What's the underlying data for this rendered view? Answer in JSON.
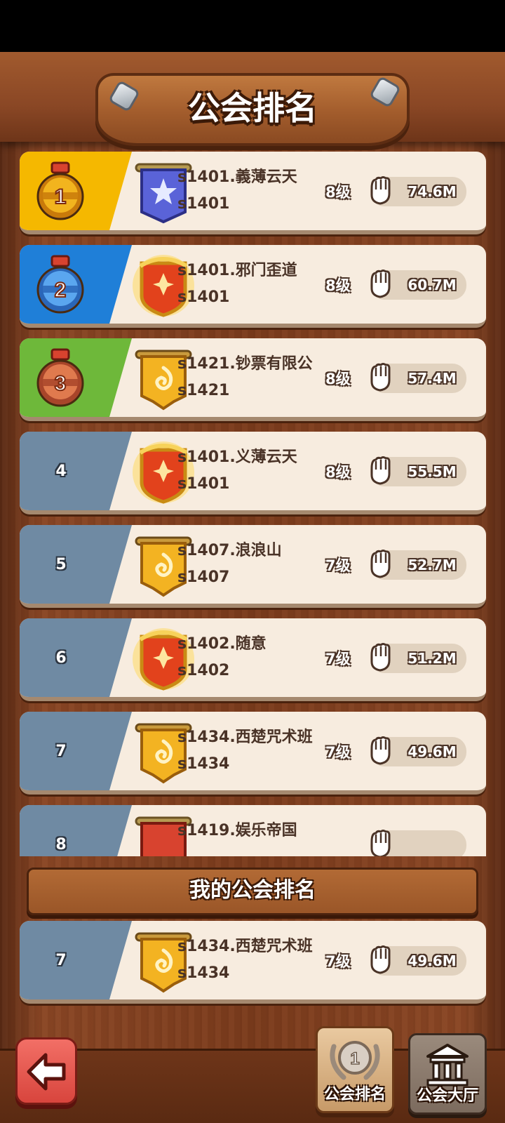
{
  "header": {
    "title": "公会排名"
  },
  "guilds": [
    {
      "rank": "1",
      "name": "s1401.義薄云天",
      "server": "s1401",
      "level": "8级",
      "power": "74.6M",
      "banner": "blue-star-banner"
    },
    {
      "rank": "2",
      "name": "s1401.邪门歪道",
      "server": "s1401",
      "level": "8级",
      "power": "60.7M",
      "banner": "fiery-crest-banner"
    },
    {
      "rank": "3",
      "name": "s1421.钞票有限公",
      "server": "s1421",
      "level": "8级",
      "power": "57.4M",
      "banner": "gold-swirl-banner"
    },
    {
      "rank": "4",
      "name": "s1401.义薄云天",
      "server": "s1401",
      "level": "8级",
      "power": "55.5M",
      "banner": "fiery-crest-banner"
    },
    {
      "rank": "5",
      "name": "s1407.浪浪山",
      "server": "s1407",
      "level": "7级",
      "power": "52.7M",
      "banner": "gold-swirl-banner"
    },
    {
      "rank": "6",
      "name": "s1402.随意",
      "server": "s1402",
      "level": "7级",
      "power": "51.2M",
      "banner": "fiery-crest-banner"
    },
    {
      "rank": "7",
      "name": "s1434.西楚咒术班",
      "server": "s1434",
      "level": "7级",
      "power": "49.6M",
      "banner": "gold-swirl-banner"
    },
    {
      "rank": "8",
      "name": "s1419.娱乐帝国",
      "server": "",
      "level": "",
      "power": "",
      "banner": "red-banner"
    }
  ],
  "my_guild_header": "我的公会排名",
  "my_guild": {
    "rank": "7",
    "name": "s1434.西楚咒术班",
    "server": "s1434",
    "level": "7级",
    "power": "49.6M",
    "banner": "gold-swirl-banner"
  },
  "nav": {
    "back_icon": "back-arrow-icon",
    "ranking_label": "公会排名",
    "ranking_badge": "1",
    "hall_label": "公会大厅"
  },
  "colors": {
    "rank1": "#f5b800",
    "rank2": "#1f7fd8",
    "rank3": "#6eb83a",
    "rank_other": "#6f8aa3",
    "card": "#f7ecdf"
  }
}
